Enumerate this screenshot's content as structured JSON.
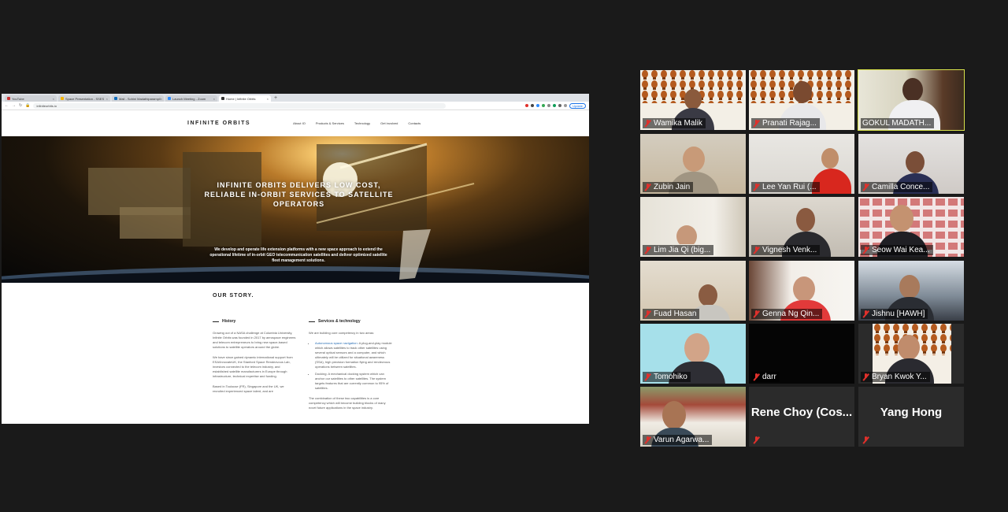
{
  "browser": {
    "tabs": [
      {
        "label": "YouTube",
        "active": false
      },
      {
        "label": "Space Presentation - SSES",
        "active": false
      },
      {
        "label": "Mail - Sohini Madathiparampil",
        "active": false
      },
      {
        "label": "Launch Meeting - Zoom",
        "active": false
      },
      {
        "label": "Home | Infinite Orbits",
        "active": true
      }
    ],
    "new_tab": "+",
    "url": "infiniteorbits.io",
    "update_label": "Update"
  },
  "site": {
    "logo": "INFINITE ORBITS",
    "menu": [
      "About IO",
      "Products & Services",
      "Technology",
      "Get involved",
      "Contacts"
    ],
    "hero_title": "INFINITE ORBITS DELIVERS LOW COST, RELIABLE IN-ORBIT SERVICES TO SATELLITE OPERATORS",
    "hero_sub": "We develop and operate life extension platforms with a new space approach to extend the operational lifetime of in-orbit GEO telecommunication satellites and deliver optimized satellite fleet management solutions.",
    "story_title": "OUR STORY.",
    "history": {
      "heading": "History",
      "p1": "Growing out of a NASA challenge at Columbia University, Infinite Orbits was founded in 2017 by aerospace engineers and telecom entrepreneurs to bring new space-based solutions to satellite operators around the globe.",
      "p2": "We have since gained dynamic international support from ESA/InnovateUK, the Stanford Space Rendezvous Lab, investors connected to the telecom industry, and established satellite manufacturers in Europe through infrastructure, technical expertise and funding.",
      "p3": "Based in Toulouse (FR), Singapore and the UK, we recruited experienced space talent, and are"
    },
    "services": {
      "heading": "Services & technology",
      "intro": "We are building core competency in two areas:",
      "item1_hl": "Autonomous space navigation:",
      "item1": "A plug-and-play module which allows satellites to track other satellites using several optical sensors and a computer, and which ultimately will be utilized for situational awareness (SSA), high precision formation flying and rendezvous operations between satellites.",
      "item2_hl": "Docking:",
      "item2": "A mechanical docking system which can anchor our satellites to other satellites. The system targets features that are currently common to 95% of satellites.",
      "p_end": "The combination of these two capabilities is a core competency which will become building blocks of many novel future applications in the space industry."
    }
  },
  "participants": [
    {
      "name": "Wamika Malik",
      "muted": true
    },
    {
      "name": "Pranati Rajag...",
      "muted": true
    },
    {
      "name": "GOKUL MADATH...",
      "muted": false,
      "active": true
    },
    {
      "name": "Zubin Jain",
      "muted": true
    },
    {
      "name": "Lee Yan Rui (...",
      "muted": true
    },
    {
      "name": "Camilla Conce...",
      "muted": true
    },
    {
      "name": "Lim Jia Qi (big...",
      "muted": true
    },
    {
      "name": "Vignesh Venk...",
      "muted": true
    },
    {
      "name": "Seow Wai Kea...",
      "muted": true
    },
    {
      "name": "Fuad Hasan",
      "muted": true
    },
    {
      "name": "Genna Ng Qin...",
      "muted": true
    },
    {
      "name": "Jishnu [HAWH]",
      "muted": true
    },
    {
      "name": "Tomohiko",
      "muted": true
    },
    {
      "name": "darr",
      "muted": true
    },
    {
      "name": "Bryan Kwok Y...",
      "muted": true
    },
    {
      "name": "Varun Agarwa...",
      "muted": true
    },
    {
      "name": "Rene Choy (Cos...",
      "muted": true,
      "video_off": true
    },
    {
      "name": "Yang Hong",
      "muted": true,
      "video_off": true
    }
  ],
  "colors": {
    "active_speaker": "#d8e24b",
    "muted_mic": "#e0302b",
    "background": "#1a1a1a"
  }
}
